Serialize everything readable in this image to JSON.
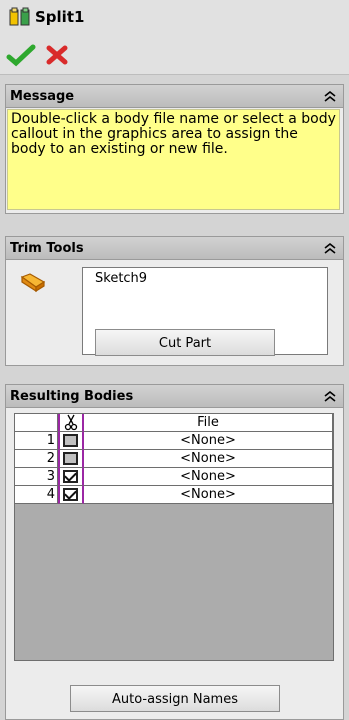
{
  "feature": {
    "title": "Split1",
    "icon": "split-feature-icon"
  },
  "actions": {
    "ok_icon": "checkmark-icon",
    "cancel_icon": "close-icon",
    "ok_color": "#2ea82e",
    "cancel_color": "#d92b2b"
  },
  "message": {
    "header": "Message",
    "text": "Double-click a body file name or select a body callout in the graphics area to assign the body to an existing or new file.",
    "background": "#ffff8a"
  },
  "trim_tools": {
    "header": "Trim Tools",
    "icon": "trim-tool-icon",
    "items": [
      "Sketch9"
    ],
    "button_label": "Cut Part"
  },
  "resulting_bodies": {
    "header": "Resulting Bodies",
    "columns": [
      "",
      "✂",
      "File"
    ],
    "rows": [
      {
        "num": "1",
        "checked": false,
        "file": "<None>"
      },
      {
        "num": "2",
        "checked": false,
        "file": "<None>"
      },
      {
        "num": "3",
        "checked": true,
        "file": "<None>"
      },
      {
        "num": "4",
        "checked": true,
        "file": "<None>"
      }
    ],
    "button_label": "Auto-assign Names"
  }
}
